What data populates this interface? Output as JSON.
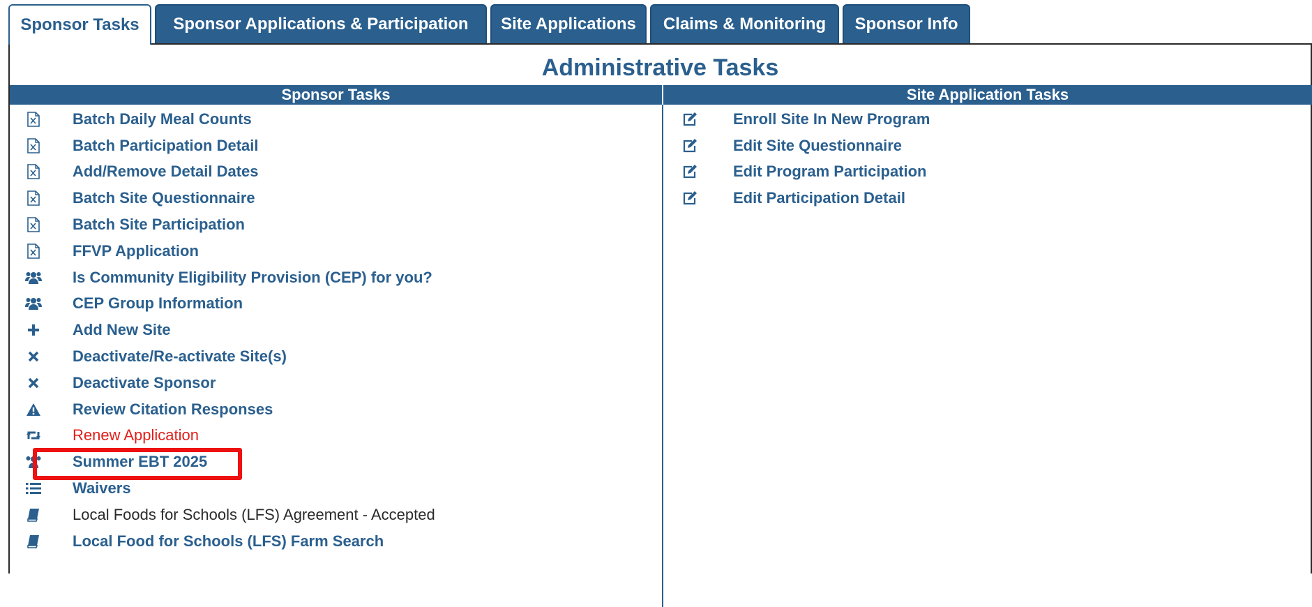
{
  "tabs": [
    {
      "label": "Sponsor Tasks",
      "active": true
    },
    {
      "label": "Sponsor Applications & Participation",
      "active": false
    },
    {
      "label": "Site Applications",
      "active": false
    },
    {
      "label": "Claims & Monitoring",
      "active": false
    },
    {
      "label": "Sponsor Info",
      "active": false
    }
  ],
  "panel": {
    "title": "Administrative Tasks",
    "left_header": "Sponsor Tasks",
    "right_header": "Site Application Tasks"
  },
  "sponsor_tasks": [
    {
      "label": "Batch Daily Meal Counts",
      "icon": "excel-file-icon"
    },
    {
      "label": "Batch Participation Detail",
      "icon": "excel-file-icon"
    },
    {
      "label": "Add/Remove Detail Dates",
      "icon": "excel-file-icon"
    },
    {
      "label": "Batch Site Questionnaire",
      "icon": "excel-file-icon"
    },
    {
      "label": "Batch Site Participation",
      "icon": "excel-file-icon"
    },
    {
      "label": "FFVP Application",
      "icon": "excel-file-icon"
    },
    {
      "label": "Is Community Eligibility Provision (CEP) for you?",
      "icon": "group-icon"
    },
    {
      "label": "CEP Group Information",
      "icon": "group-icon"
    },
    {
      "label": "Add New Site",
      "icon": "plus-icon"
    },
    {
      "label": "Deactivate/Re-activate Site(s)",
      "icon": "close-icon"
    },
    {
      "label": "Deactivate Sponsor",
      "icon": "close-icon"
    },
    {
      "label": "Review Citation Responses",
      "icon": "warning-icon"
    },
    {
      "label": "Renew Application",
      "icon": "retweet-icon",
      "style": "red"
    },
    {
      "label": "Summer EBT 2025",
      "icon": "group-icon",
      "highlighted": true
    },
    {
      "label": "Waivers",
      "icon": "list-icon"
    },
    {
      "label": "Local Foods for Schools (LFS) Agreement - Accepted",
      "icon": "book-icon",
      "style": "plain"
    },
    {
      "label": "Local Food for Schools (LFS) Farm Search",
      "icon": "book-icon"
    }
  ],
  "site_application_tasks": [
    {
      "label": "Enroll Site In New Program",
      "icon": "edit-icon"
    },
    {
      "label": "Edit Site Questionnaire",
      "icon": "edit-icon"
    },
    {
      "label": "Edit Program Participation",
      "icon": "edit-icon"
    },
    {
      "label": "Edit Participation Detail",
      "icon": "edit-icon"
    }
  ],
  "colors": {
    "primary": "#2a5f8e",
    "highlight": "#ee1111",
    "red_link": "#e0201b"
  }
}
